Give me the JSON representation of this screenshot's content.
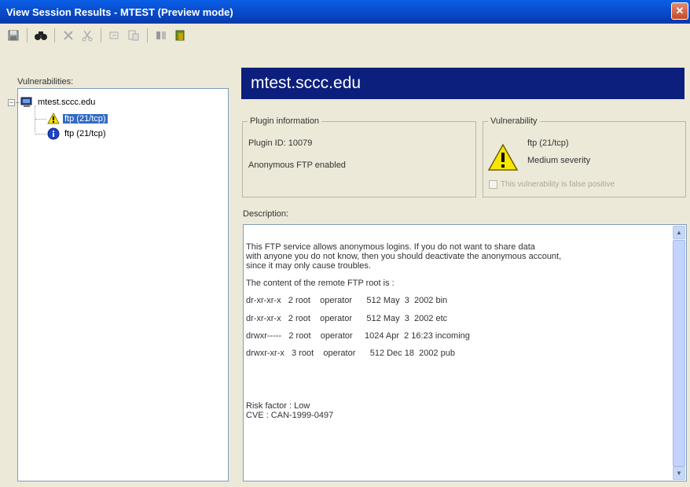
{
  "window": {
    "title": "View Session Results - MTEST (Preview mode)",
    "close_glyph": "✕"
  },
  "toolbar": {
    "icons": [
      "save-icon",
      "find-icon",
      "delete-icon",
      "cut-icon",
      "copy-icon",
      "paste-icon",
      "properties-icon",
      "exit-icon"
    ]
  },
  "left": {
    "vulnerabilities_label": "Vulnerabilities:",
    "tree": {
      "host": "mtest.sccc.edu",
      "expander": "−",
      "items": [
        {
          "label": "ftp (21/tcp)",
          "severity": "medium",
          "selected": true
        },
        {
          "label": "ftp (21/tcp)",
          "severity": "info",
          "selected": false
        }
      ]
    }
  },
  "main": {
    "host_header": "mtest.sccc.edu",
    "plugin_info": {
      "title": "Plugin information",
      "plugin_id": "Plugin ID: 10079",
      "name": "Anonymous FTP enabled"
    },
    "vulnerability": {
      "title": "Vulnerability",
      "port": "ftp (21/tcp)",
      "severity": "Medium severity",
      "false_positive_label": "This vulnerability is false positive"
    },
    "description_label": "Description:",
    "description_lines": [
      "This FTP service allows anonymous logins. If you do not want to share data",
      "with anyone you do not know, then you should deactivate the anonymous account,",
      "since it may only cause troubles.",
      "The content of the remote FTP root is :",
      "dr-xr-xr-x   2 root    operator      512 May  3  2002 bin",
      "dr-xr-xr-x   2 root    operator      512 May  3  2002 etc",
      "drwxr-----   2 root    operator     1024 Apr  2 16:23 incoming",
      "drwxr-xr-x   3 root    operator      512 Dec 18  2002 pub",
      "Risk factor : Low",
      "CVE : CAN-1999-0497"
    ]
  },
  "colors": {
    "titlebar": "#0848c6",
    "host_header": "#0c1f7c",
    "selection": "#316ac5",
    "warning": "#f7e600",
    "info": "#1c43c9"
  }
}
